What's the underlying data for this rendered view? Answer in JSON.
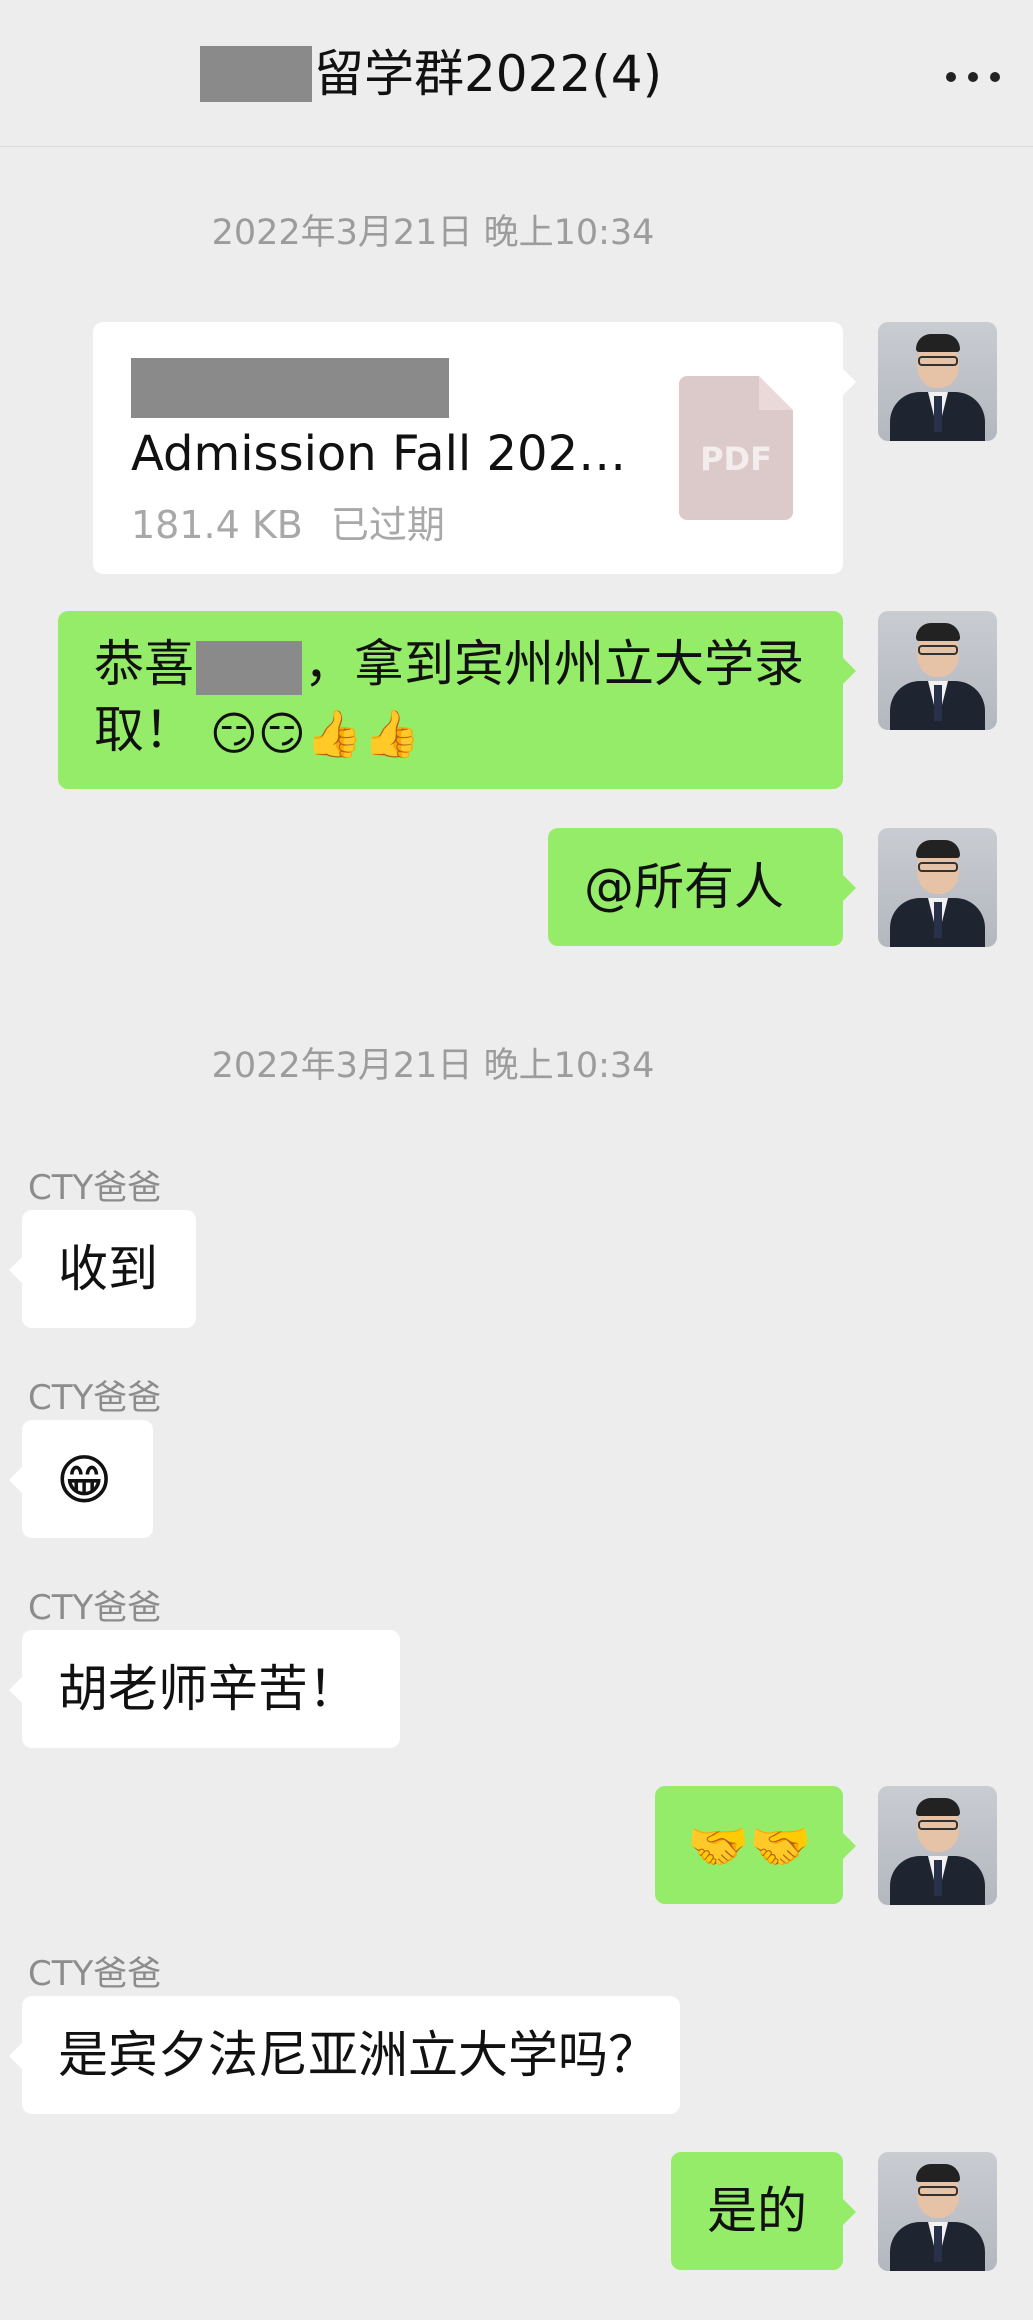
{
  "header": {
    "title": "留学群2022(4)"
  },
  "timestamps": [
    "2022年3月21日 晚上10:34",
    "2022年3月21日 晚上10:34"
  ],
  "file_message": {
    "name": "Admission Fall 202…",
    "size": "181.4 KB",
    "status": "已过期",
    "badge": "PDF"
  },
  "messages": {
    "congrats_prefix": "恭喜",
    "congrats_suffix": "，拿到宾州州立大学录取！",
    "congrats_emoji": "😏😏👍👍",
    "mention_all": "@所有人",
    "sender_name": "CTY爸爸",
    "received": "收到",
    "grin": "😁",
    "thanks": "胡老师辛苦！",
    "handshake": "🤝🤝",
    "question": "是宾夕法尼亚洲立大学吗？",
    "yes": "是的"
  }
}
